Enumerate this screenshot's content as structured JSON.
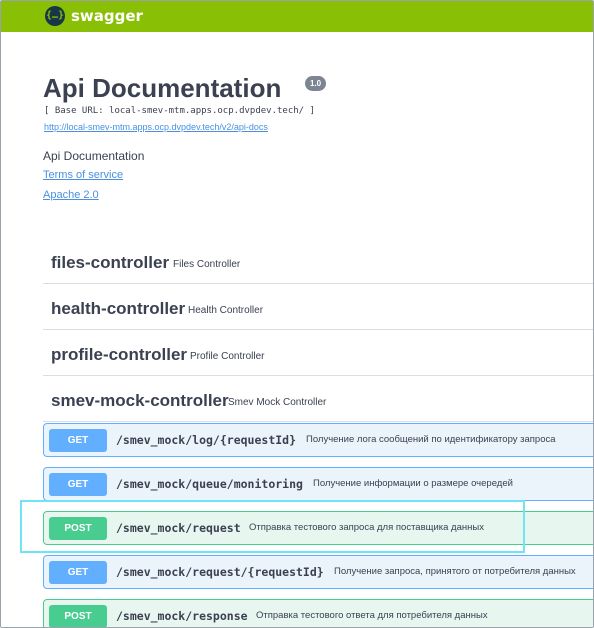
{
  "brand": {
    "logo_glyph": "{…}",
    "name": "swagger"
  },
  "info": {
    "title": "Api Documentation",
    "version": "1.0",
    "base_url": "[ Base URL: local-smev-mtm.apps.ocp.dvpdev.tech/ ]",
    "docs_url": "http://local-smev-mtm.apps.ocp.dvpdev.tech/v2/api-docs",
    "description": "Api Documentation",
    "terms_label": "Terms of service",
    "license_label": "Apache 2.0"
  },
  "tags": [
    {
      "name": "files-controller",
      "description": "Files Controller"
    },
    {
      "name": "health-controller",
      "description": "Health Controller"
    },
    {
      "name": "profile-controller",
      "description": "Profile Controller"
    },
    {
      "name": "smev-mock-controller",
      "description": "Smev Mock Controller"
    }
  ],
  "operations": [
    {
      "method": "GET",
      "path": "/smev_mock/log/{requestId}",
      "summary": "Получение лога сообщений по идентификатору запроса"
    },
    {
      "method": "GET",
      "path": "/smev_mock/queue/monitoring",
      "summary": "Получение информации о размере очередей"
    },
    {
      "method": "POST",
      "path": "/smev_mock/request",
      "summary": "Отправка тестового запроса для поставщика данных"
    },
    {
      "method": "GET",
      "path": "/smev_mock/request/{requestId}",
      "summary": "Получение запроса, принятого от потребителя данных"
    },
    {
      "method": "POST",
      "path": "/smev_mock/response",
      "summary": "Отправка тестового ответа для потребителя данных"
    }
  ],
  "colors": {
    "topbar": "#89bf04",
    "get": "#61affe",
    "post": "#49cc90",
    "highlight": "#6ee4f5"
  }
}
